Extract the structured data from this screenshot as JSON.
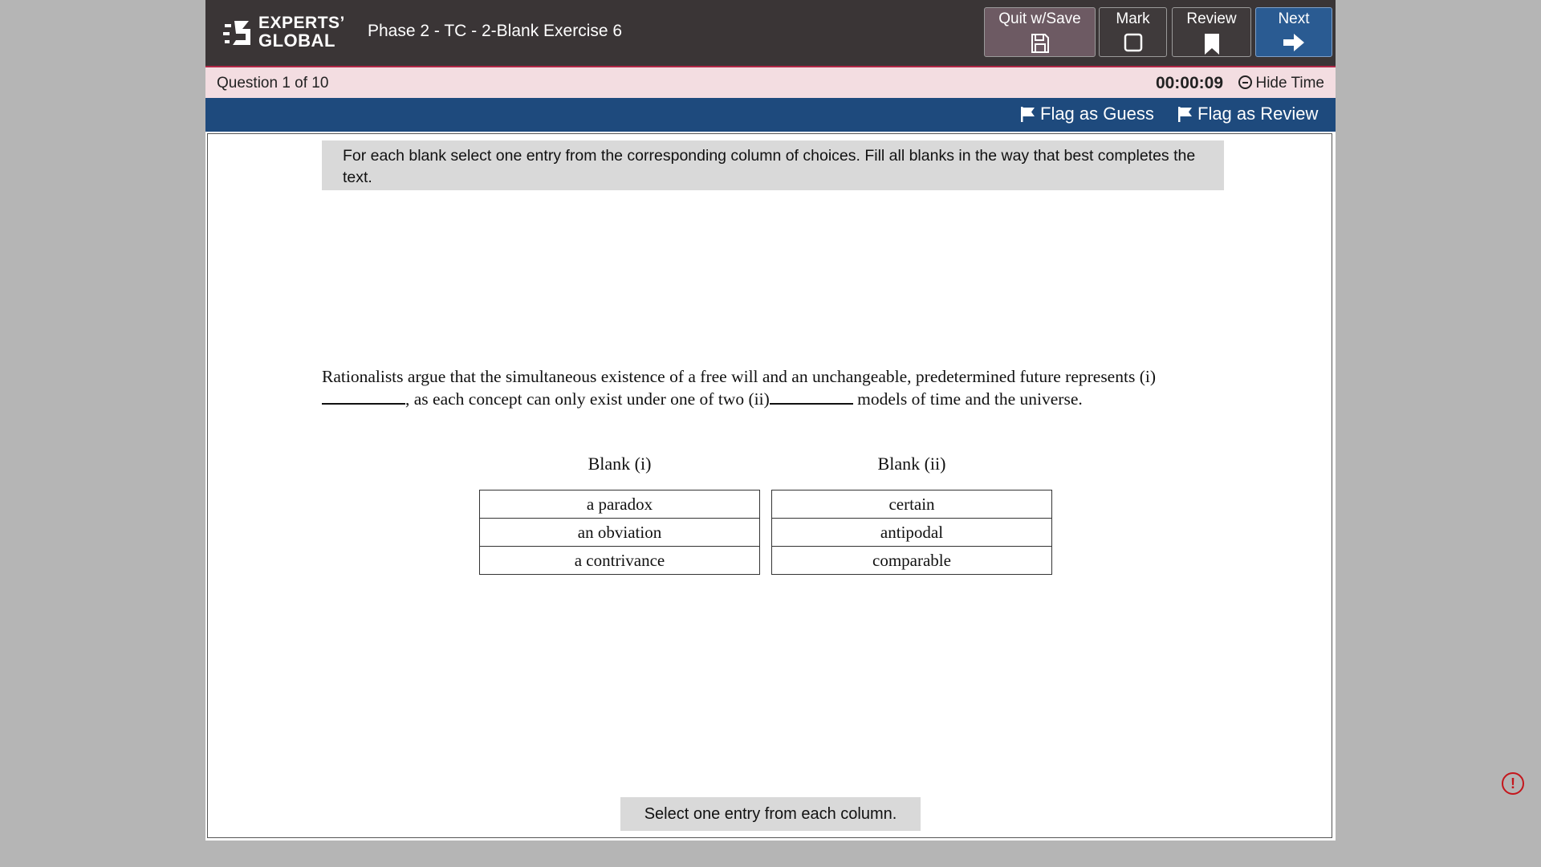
{
  "header": {
    "logo_line1": "EXPERTS’",
    "logo_line2": "GLOBAL",
    "title": "Phase 2 - TC - 2-Blank Exercise 6",
    "buttons": {
      "quit": "Quit w/Save",
      "mark": "Mark",
      "review": "Review",
      "next": "Next"
    }
  },
  "status_bar": {
    "question_label": "Question",
    "question_number": "1 of 10",
    "timer": "00:00:09",
    "hide_time": "Hide Time"
  },
  "flags": {
    "guess": "Flag as Guess",
    "review": "Flag as Review"
  },
  "instructions": "For each blank select one entry from the corresponding column of choices. Fill all blanks in the way that best completes the text.",
  "passage": {
    "part1": "Rationalists argue that the simultaneous existence of a free will and an unchangeable, predetermined future represents (i)",
    "part2": ", as each concept can only exist under one of two (ii)",
    "part3": " models of time and the universe."
  },
  "blanks": [
    {
      "header": "Blank (i)",
      "choices": [
        "a paradox",
        "an obviation",
        "a contrivance"
      ]
    },
    {
      "header": "Blank (ii)",
      "choices": [
        "certain",
        "antipodal",
        "comparable"
      ]
    }
  ],
  "footer_message": "Select one entry from each column.",
  "alert_glyph": "!",
  "colors": {
    "header_bg": "#3a3536",
    "flag_bar": "#1e4a7d",
    "status_bar": "#f3dde1",
    "next_button": "#2a5b92",
    "accent_red": "#b02747"
  }
}
